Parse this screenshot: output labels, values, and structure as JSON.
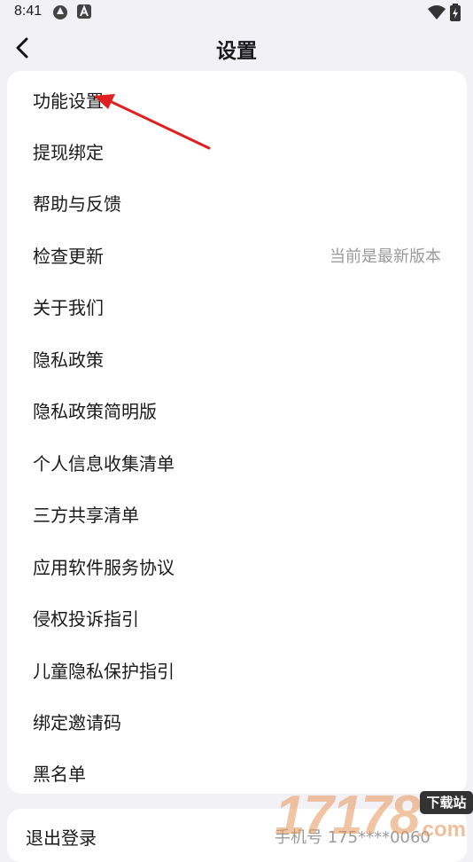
{
  "status_bar": {
    "time": "8:41"
  },
  "header": {
    "title": "设置"
  },
  "settings": {
    "items": [
      {
        "label": "功能设置"
      },
      {
        "label": "提现绑定"
      },
      {
        "label": "帮助与反馈"
      },
      {
        "label": "检查更新",
        "value": "当前是最新版本"
      },
      {
        "label": "关于我们"
      },
      {
        "label": "隐私政策"
      },
      {
        "label": "隐私政策简明版"
      },
      {
        "label": "个人信息收集清单"
      },
      {
        "label": "三方共享清单"
      },
      {
        "label": "应用软件服务协议"
      },
      {
        "label": "侵权投诉指引"
      },
      {
        "label": "儿童隐私保护指引"
      },
      {
        "label": "绑定邀请码"
      },
      {
        "label": "黑名单"
      }
    ]
  },
  "logout": {
    "label": "退出登录",
    "phone": "手机号 175****0060"
  },
  "watermark": {
    "digits": "17178",
    "badge": "下载站",
    "com": ".com"
  },
  "colors": {
    "page_bg": "#f2f2f6",
    "card_bg": "#ffffff",
    "secondary_text": "#9a9a9a",
    "annotation_arrow": "#e02020"
  }
}
